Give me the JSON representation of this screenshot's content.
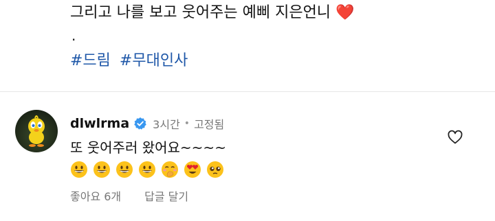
{
  "post": {
    "caption_line": "그리고 나를 보고 웃어주는 예삐 지은언니",
    "caption_emoji": "❤️",
    "dot": ".",
    "hashtags": [
      "#드림",
      "#무대인사"
    ]
  },
  "comment": {
    "username": "dlwlrma",
    "time": "3시간",
    "separator": "•",
    "pinned_label": "고정됨",
    "text": "또 웃어주러 왔어요~~~~",
    "emojis": [
      "grinning-face",
      "grinning-face",
      "grinning-face",
      "grinning-face",
      "hand-over-mouth-face",
      "heart-eyes-face",
      "pleading-face"
    ],
    "likes_label": "좋아요 6개",
    "reply_label": "답글 달기"
  },
  "icons": {
    "verified": "verified-badge-icon",
    "like": "heart-outline-icon"
  },
  "colors": {
    "hashtag": "#1e57a8",
    "verified": "#3897f0",
    "heart": "#e0212c",
    "muted": "#777777"
  }
}
